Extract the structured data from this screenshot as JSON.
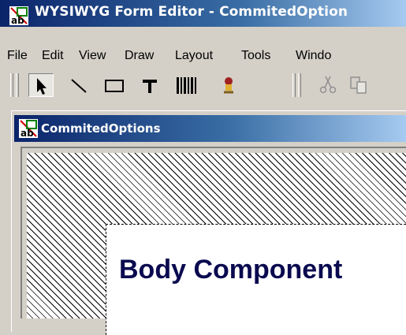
{
  "window": {
    "title": "WYSIWYG Form Editor - CommitedOption"
  },
  "menubar": {
    "items": [
      "File",
      "Edit",
      "View",
      "Draw",
      "Layout",
      "Tools",
      "Windo"
    ]
  },
  "toolbar": {
    "tools": [
      {
        "name": "select-tool",
        "icon": "arrow-pointer-icon"
      },
      {
        "name": "line-tool",
        "icon": "diagonal-line-icon"
      },
      {
        "name": "rectangle-tool",
        "icon": "rectangle-icon"
      },
      {
        "name": "text-tool",
        "icon": "text-t-icon"
      },
      {
        "name": "barcode-tool",
        "icon": "barcode-icon"
      },
      {
        "name": "image-tool",
        "icon": "figure-icon"
      },
      {
        "name": "cut-button",
        "icon": "scissors-icon"
      },
      {
        "name": "copy-button",
        "icon": "copy-icon"
      }
    ]
  },
  "child_window": {
    "title": "CommitedOptions"
  },
  "canvas": {
    "component_label": "Body Component"
  },
  "colors": {
    "titlebar_start": "#0a246a",
    "titlebar_end": "#a6caf0",
    "label": "#0a0a50"
  }
}
